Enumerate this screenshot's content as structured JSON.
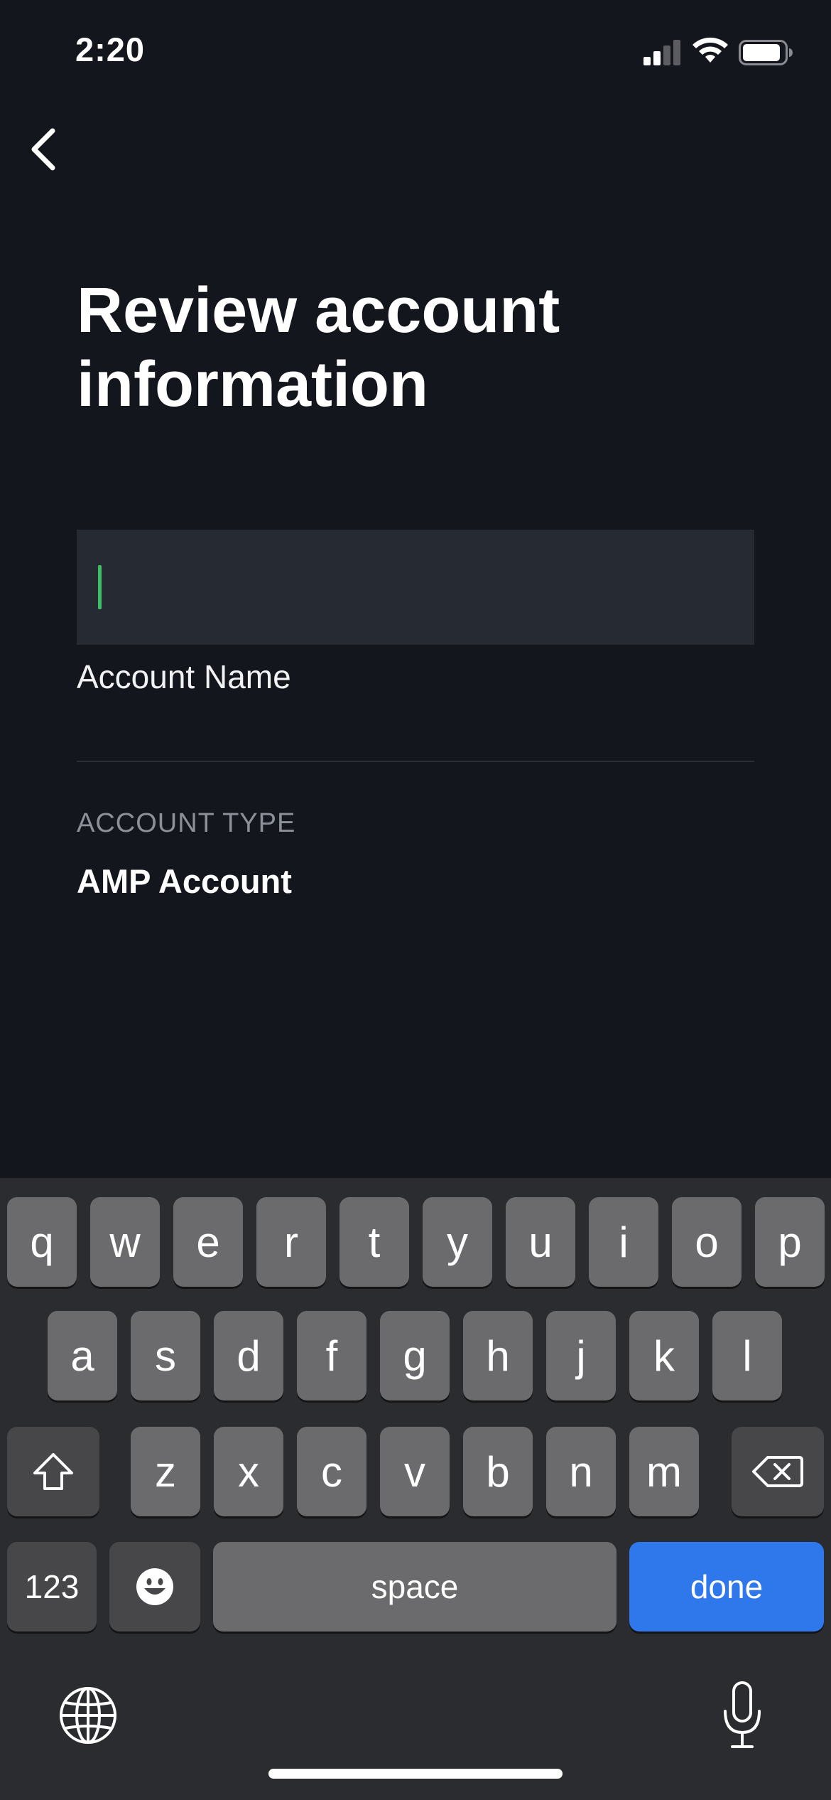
{
  "status_bar": {
    "time": "2:20"
  },
  "header": {
    "back_label": "Back"
  },
  "page": {
    "title": "Review account information"
  },
  "form": {
    "account_name": {
      "value": "",
      "label": "Account Name"
    },
    "account_type": {
      "label": "ACCOUNT TYPE",
      "value": "AMP Account"
    }
  },
  "keyboard": {
    "row1": [
      "q",
      "w",
      "e",
      "r",
      "t",
      "y",
      "u",
      "i",
      "o",
      "p"
    ],
    "row2": [
      "a",
      "s",
      "d",
      "f",
      "g",
      "h",
      "j",
      "k",
      "l"
    ],
    "row3": [
      "z",
      "x",
      "c",
      "v",
      "b",
      "n",
      "m"
    ],
    "numbers_label": "123",
    "space_label": "space",
    "done_label": "done"
  },
  "colors": {
    "background": "#14161d",
    "field": "#262a33",
    "cursor": "#3fbf63",
    "key": "#6b6b6d",
    "key_dark": "#474749",
    "done": "#2f78ec"
  },
  "icons": [
    "cellular-signal-icon",
    "wifi-icon",
    "battery-icon",
    "chevron-left-icon",
    "shift-icon",
    "delete-icon",
    "emoji-icon",
    "globe-icon",
    "microphone-icon"
  ]
}
